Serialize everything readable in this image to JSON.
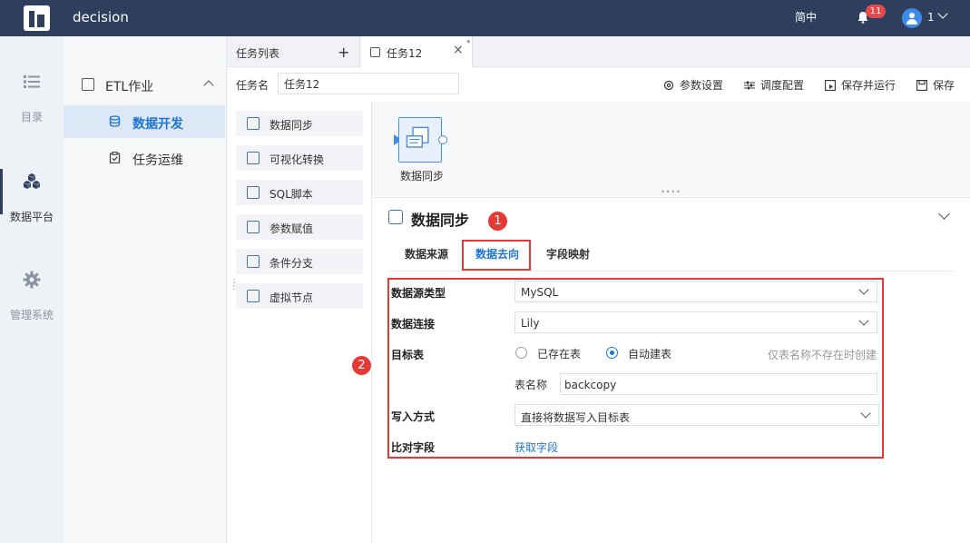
{
  "app": {
    "title": "decision"
  },
  "header": {
    "lang": "简中",
    "notifications": "11",
    "user": "1"
  },
  "rail": [
    {
      "label": "目录",
      "icon": "list-icon"
    },
    {
      "label": "数据平台",
      "icon": "cubes-icon"
    },
    {
      "label": "管理系统",
      "icon": "gear-icon"
    }
  ],
  "subnav": {
    "group": "ETL作业",
    "items": [
      {
        "label": "数据开发",
        "icon": "database-icon"
      },
      {
        "label": "任务运维",
        "icon": "clipboard-icon"
      }
    ]
  },
  "tabs": {
    "list_label": "任务列表",
    "add": "+",
    "task_label": "任务12",
    "close": "×",
    "modified": "*"
  },
  "taskbar": {
    "name_label": "任务名",
    "name_value": "任务12",
    "actions": [
      "参数设置",
      "调度配置",
      "保存并运行",
      "保存"
    ]
  },
  "palette": [
    "数据同步",
    "可视化转换",
    "SQL脚本",
    "参数赋值",
    "条件分支",
    "虚拟节点"
  ],
  "canvas": {
    "node_label": "数据同步"
  },
  "panel": {
    "title": "数据同步",
    "marker1": "1",
    "marker2": "2",
    "tabs": [
      "数据来源",
      "数据去向",
      "字段映射"
    ],
    "form": {
      "source_type_label": "数据源类型",
      "source_type_value": "MySQL",
      "connection_label": "数据连接",
      "connection_value": "Lily",
      "target_label": "目标表",
      "target_existing": "已存在表",
      "target_auto": "自动建表",
      "target_hint": "仅表名称不存在时创建",
      "table_name_label": "表名称",
      "table_name_value": "backcopy",
      "write_mode_label": "写入方式",
      "write_mode_value": "直接将数据写入目标表",
      "compare_label": "比对字段",
      "compare_link": "获取字段"
    }
  },
  "colors": {
    "header_bg": "#2d3f5c",
    "accent": "#1e74d6",
    "highlight": "#e53935"
  }
}
